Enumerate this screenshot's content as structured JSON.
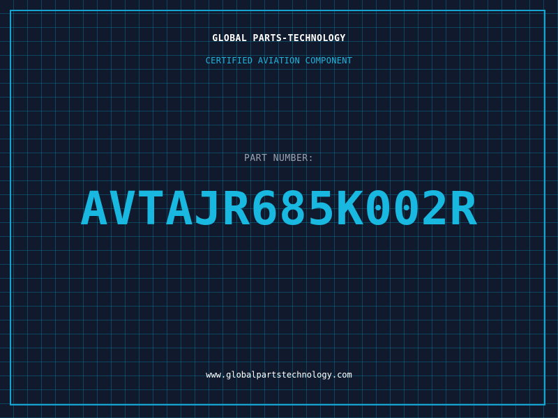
{
  "header": {
    "company": "GLOBAL PARTS-TECHNOLOGY",
    "subtitle": "CERTIFIED AVIATION COMPONENT"
  },
  "part": {
    "label": "PART NUMBER:",
    "number": "AVTAJR685K002R"
  },
  "footer": {
    "website": "www.globalpartstechnology.com"
  },
  "colors": {
    "background": "#111a2d",
    "accent": "#18b8e0",
    "grid": "#0a5f78",
    "label": "#9aa3b2",
    "text": "#ffffff"
  }
}
